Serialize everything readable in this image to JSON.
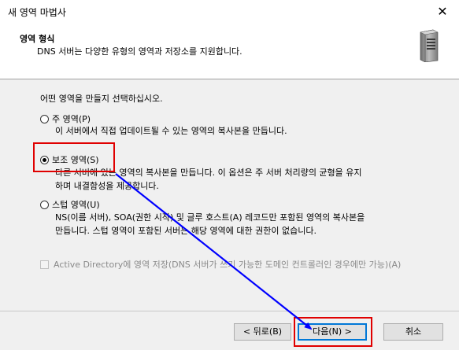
{
  "window": {
    "title": "새 영역 마법사",
    "close_glyph": "✕"
  },
  "header": {
    "title": "영역 형식",
    "subtitle": "DNS 서버는 다양한 유형의 영역과 저장소를 지원합니다.",
    "icon": "server-icon"
  },
  "prompt": "어떤 영역을 만들지 선택하십시오.",
  "options": [
    {
      "label": "주 영역(P)",
      "checked": false,
      "desc": [
        "이 서버에서 직접 업데이트될 수 있는 영역의 복사본을 만듭니다."
      ]
    },
    {
      "label": "보조 영역(S)",
      "checked": true,
      "desc": [
        "다른 서버에 있는 영역의 복사본을 만듭니다. 이 옵션은 주 서버 처리량의 균형을 유지",
        "하며 내결함성을 제공합니다."
      ]
    },
    {
      "label": "스텁 영역(U)",
      "checked": false,
      "desc": [
        "NS(이름 서버), SOA(권한 시작) 및 글루 호스트(A) 레코드만 포함된 영역의 복사본을",
        "만듭니다. 스텁 영역이 포함된 서버는 해당 영역에 대한 권한이 없습니다."
      ]
    }
  ],
  "ad_checkbox": {
    "label": "Active Directory에 영역 저장(DNS 서버가 쓰기 가능한 도메인 컨트롤러인 경우에만 가능)(A)",
    "checked": false,
    "enabled": false
  },
  "buttons": {
    "back": "< 뒤로(B)",
    "next": "다음(N) >",
    "cancel": "취소"
  },
  "annotation_colors": {
    "highlight": "#e00000",
    "arrow": "#0000ff"
  }
}
